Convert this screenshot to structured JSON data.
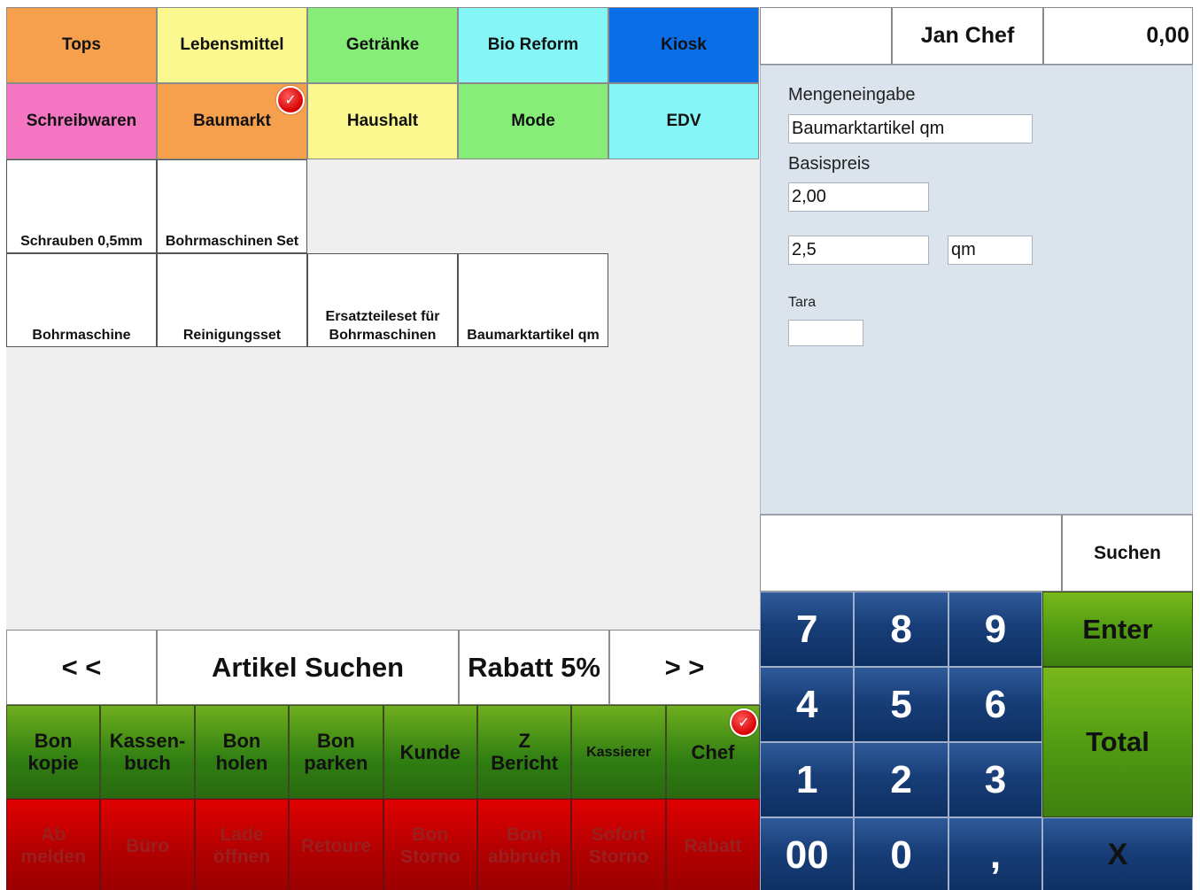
{
  "categories": [
    {
      "label": "Tops",
      "color": "#f6a04e"
    },
    {
      "label": "Lebensmittel",
      "color": "#fbf88f"
    },
    {
      "label": "Getränke",
      "color": "#86ee78"
    },
    {
      "label": "Bio Reform",
      "color": "#86f5f6"
    },
    {
      "label": "Kiosk",
      "color": "#0a6fe6"
    },
    {
      "label": "Schreibwaren",
      "color": "#f476c2"
    },
    {
      "label": "Baumarkt",
      "color": "#f6a04e",
      "selected": true
    },
    {
      "label": "Haushalt",
      "color": "#fbf88f"
    },
    {
      "label": "Mode",
      "color": "#86ee78"
    },
    {
      "label": "EDV",
      "color": "#86f5f6"
    }
  ],
  "products_row1": [
    "Schrauben 0,5mm",
    "Bohrmaschinen Set"
  ],
  "products_row2": [
    "Bohrmaschine",
    "Reinigungsset",
    "Ersatzteileset für\nBohrmaschinen",
    "Baumarktartikel qm"
  ],
  "nav": {
    "prev": "< <",
    "search": "Artikel Suchen",
    "discount": "Rabatt 5%",
    "next": "> >"
  },
  "function_row_green": [
    {
      "label": "Bon\nkopie"
    },
    {
      "label": "Kassen-\nbuch"
    },
    {
      "label": "Bon\nholen"
    },
    {
      "label": "Bon\nparken"
    },
    {
      "label": "Kunde"
    },
    {
      "label": "Z\nBericht"
    },
    {
      "label": "Kassierer",
      "small": true
    },
    {
      "label": "Chef",
      "selected": true
    }
  ],
  "function_row_red": [
    {
      "label": "Ab\nmelden"
    },
    {
      "label": "Büro"
    },
    {
      "label": "Lade\nöffnen"
    },
    {
      "label": "Retoure"
    },
    {
      "label": "Bon\nStorno"
    },
    {
      "label": "Bon\nabbruch"
    },
    {
      "label": "Sofort\nStorno"
    },
    {
      "label": "Rabatt"
    }
  ],
  "header": {
    "user": "Jan Chef",
    "amount": "0,00"
  },
  "quantity_panel": {
    "title": "Mengeneingabe",
    "article_value": "Baumarktartikel qm",
    "base_price_label": "Basispreis",
    "base_price_value": "2,00",
    "quantity_value": "2,5",
    "unit_value": "qm",
    "tara_label": "Tara",
    "tara_value": ""
  },
  "search_button": "Suchen",
  "keypad": {
    "keys": [
      "7",
      "8",
      "9",
      "4",
      "5",
      "6",
      "1",
      "2",
      "3",
      "00",
      "0",
      ","
    ],
    "enter": "Enter",
    "total": "Total",
    "clear": "X"
  },
  "colors": {
    "panel_bg": "#dbe3ec",
    "workspace_bg": "#efefef",
    "green_button": "#4f9a12",
    "red_button": "#c00000",
    "keypad_blue": "#183e78"
  }
}
